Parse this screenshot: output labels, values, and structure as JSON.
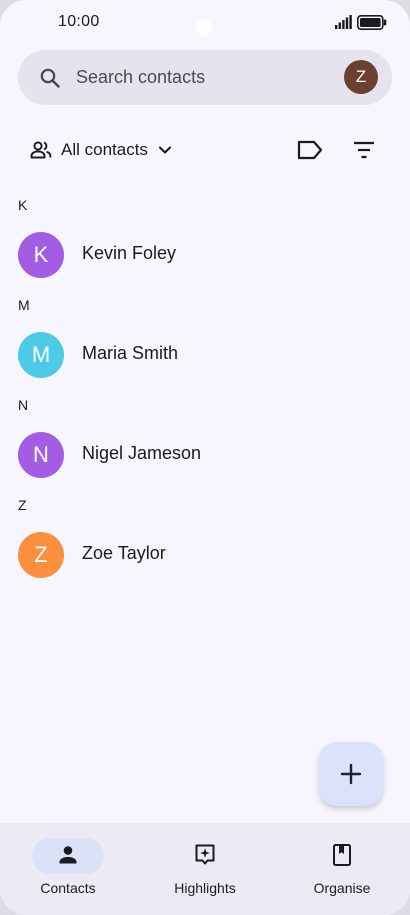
{
  "status_bar": {
    "time": "10:00"
  },
  "search": {
    "placeholder": "Search contacts",
    "account_initial": "Z",
    "account_color": "#6b4031"
  },
  "toolbar": {
    "filter_label": "All contacts"
  },
  "contacts": [
    {
      "letter": "K",
      "name": "Kevin Foley",
      "initial": "K",
      "color": "#a35de4"
    },
    {
      "letter": "M",
      "name": "Maria Smith",
      "initial": "M",
      "color": "#4dcbe6"
    },
    {
      "letter": "N",
      "name": "Nigel Jameson",
      "initial": "N",
      "color": "#a35de4"
    },
    {
      "letter": "Z",
      "name": "Zoe Taylor",
      "initial": "Z",
      "color": "#fa903e"
    }
  ],
  "fab": {
    "icon": "plus-icon"
  },
  "bottom_nav": {
    "items": [
      {
        "label": "Contacts",
        "icon": "person-icon",
        "active": true
      },
      {
        "label": "Highlights",
        "icon": "sparkle-icon",
        "active": false
      },
      {
        "label": "Organise",
        "icon": "bookmark-icon",
        "active": false
      }
    ],
    "active_color": "#dbe2f7"
  }
}
